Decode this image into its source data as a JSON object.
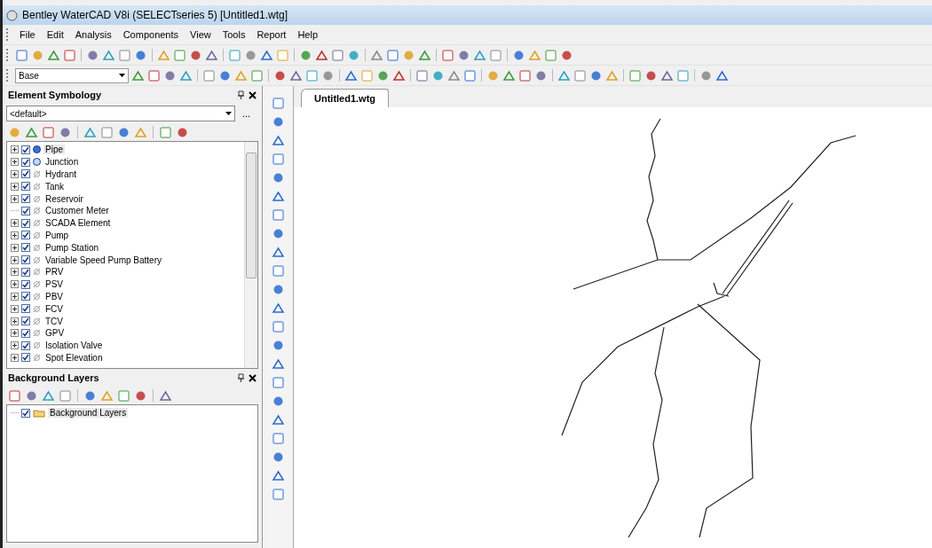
{
  "window": {
    "title": "Bentley WaterCAD V8i (SELECTseries 5) [Untitled1.wtg]"
  },
  "menu": [
    "File",
    "Edit",
    "Analysis",
    "Components",
    "View",
    "Tools",
    "Report",
    "Help"
  ],
  "toolbar_2": {
    "scenario_select": "Base"
  },
  "element_symbology": {
    "title": "Element Symbology",
    "select": "<default>",
    "more": "...",
    "items": [
      {
        "label": "Pipe",
        "checked": true,
        "kind": "filled-dot",
        "expandable": true,
        "selected": true
      },
      {
        "label": "Junction",
        "checked": true,
        "kind": "light-dot",
        "expandable": true,
        "selected": false
      },
      {
        "label": "Hydrant",
        "checked": true,
        "kind": "empty",
        "expandable": true,
        "selected": false
      },
      {
        "label": "Tank",
        "checked": true,
        "kind": "empty",
        "expandable": true,
        "selected": false
      },
      {
        "label": "Reservoir",
        "checked": true,
        "kind": "empty",
        "expandable": true,
        "selected": false
      },
      {
        "label": "Customer Meter",
        "checked": true,
        "kind": "empty",
        "expandable": false,
        "selected": false
      },
      {
        "label": "SCADA Element",
        "checked": true,
        "kind": "empty",
        "expandable": true,
        "selected": false
      },
      {
        "label": "Pump",
        "checked": true,
        "kind": "empty",
        "expandable": true,
        "selected": false
      },
      {
        "label": "Pump Station",
        "checked": true,
        "kind": "empty",
        "expandable": true,
        "selected": false
      },
      {
        "label": "Variable Speed Pump Battery",
        "checked": true,
        "kind": "empty",
        "expandable": true,
        "selected": false
      },
      {
        "label": "PRV",
        "checked": true,
        "kind": "empty",
        "expandable": true,
        "selected": false
      },
      {
        "label": "PSV",
        "checked": true,
        "kind": "empty",
        "expandable": true,
        "selected": false
      },
      {
        "label": "PBV",
        "checked": true,
        "kind": "empty",
        "expandable": true,
        "selected": false
      },
      {
        "label": "FCV",
        "checked": true,
        "kind": "empty",
        "expandable": true,
        "selected": false
      },
      {
        "label": "TCV",
        "checked": true,
        "kind": "empty",
        "expandable": true,
        "selected": false
      },
      {
        "label": "GPV",
        "checked": true,
        "kind": "empty",
        "expandable": true,
        "selected": false
      },
      {
        "label": "Isolation Valve",
        "checked": true,
        "kind": "empty",
        "expandable": true,
        "selected": false
      },
      {
        "label": "Spot Elevation",
        "checked": true,
        "kind": "empty",
        "expandable": true,
        "selected": false
      }
    ]
  },
  "background_layers": {
    "title": "Background Layers",
    "items": [
      {
        "label": "Background Layers",
        "checked": true,
        "selected": true
      }
    ]
  },
  "document_tabs": [
    {
      "label": "Untitled1.wtg",
      "selected": true
    }
  ]
}
